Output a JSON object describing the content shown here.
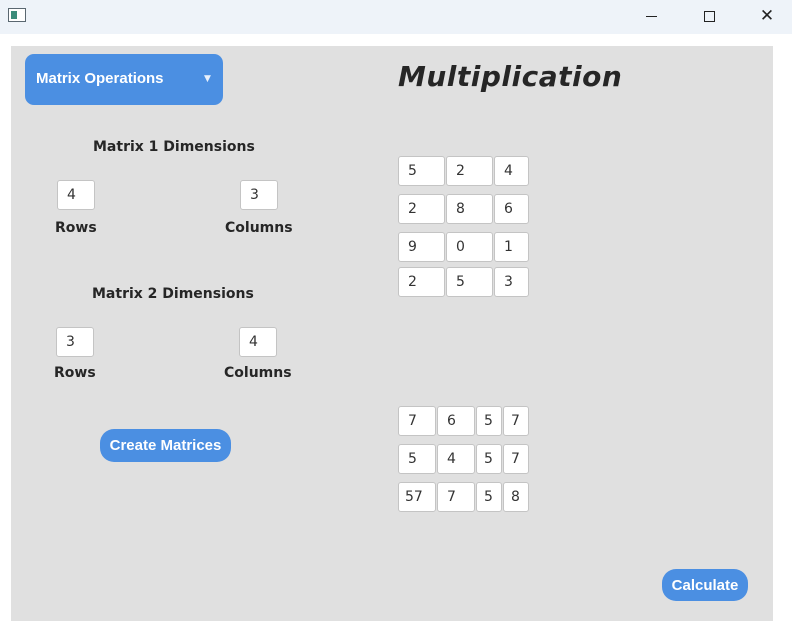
{
  "window": {
    "minimize_glyph": "",
    "maximize_glyph": "",
    "close_glyph": "✕"
  },
  "operation_select": {
    "value": "Matrix Operations",
    "arrow": "⌄"
  },
  "heading": "Multiplication",
  "matrix1_dimensions": {
    "title": "Matrix 1 Dimensions",
    "rows_value": "4",
    "columns_value": "3",
    "rows_label": "Rows",
    "columns_label": "Columns"
  },
  "matrix2_dimensions": {
    "title": "Matrix 2 Dimensions",
    "rows_value": "3",
    "columns_value": "4",
    "rows_label": "Rows",
    "columns_label": "Columns"
  },
  "create_button": "Create Matrices",
  "calculate_button": "Calculate",
  "matrix1": [
    [
      "5",
      "2",
      "4"
    ],
    [
      "2",
      "8",
      "6"
    ],
    [
      "9",
      "0",
      "1"
    ],
    [
      "2",
      "5",
      "3"
    ]
  ],
  "matrix2": [
    [
      "7",
      "6",
      "5",
      "7"
    ],
    [
      "5",
      "4",
      "5",
      "7"
    ],
    [
      "57",
      "7",
      "5",
      "8"
    ]
  ],
  "colors": {
    "accent": "#4b8fe2",
    "panel": "#e0e0e0",
    "titlebar": "#eef3f9"
  }
}
